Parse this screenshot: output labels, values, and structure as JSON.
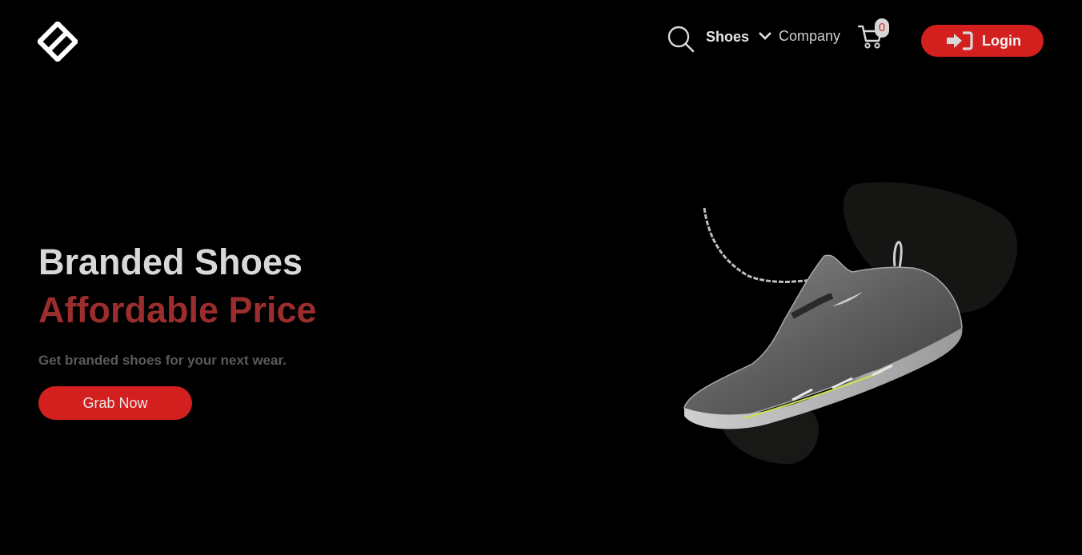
{
  "header": {
    "nav": {
      "shoes_label": "Shoes",
      "company_label": "Company"
    },
    "cart": {
      "count": "0"
    },
    "login_label": "Login"
  },
  "hero": {
    "title": "Branded Shoes",
    "subtitle": "Affordable Price",
    "description": "Get branded shoes for your next wear.",
    "cta_label": "Grab Now"
  },
  "colors": {
    "accent": "#d41f1f",
    "subtitle": "#9a2d2d",
    "background": "#000000"
  },
  "icons": {
    "logo": "diamond-logo-icon",
    "search": "search-icon",
    "dropdown": "chevron-down-icon",
    "cart": "cart-icon",
    "login": "login-arrow-icon"
  }
}
